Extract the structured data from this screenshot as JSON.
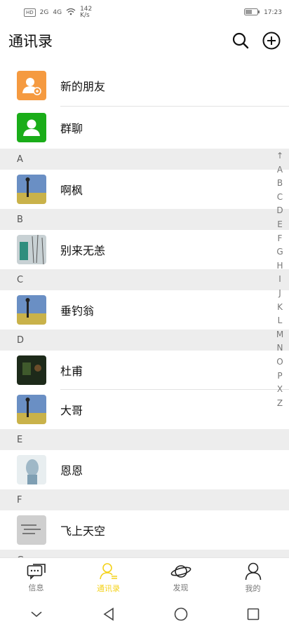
{
  "status": {
    "left_badge": "HD",
    "net1": "2G",
    "net2": "4G",
    "speed": "142\nK/s",
    "time": "17:23"
  },
  "header": {
    "title": "通讯录"
  },
  "top_items": [
    {
      "name": "新的朋友",
      "color": "#f59a40"
    },
    {
      "name": "群聊",
      "color": "#1aad19"
    }
  ],
  "sections": [
    {
      "letter": "A",
      "contacts": [
        "啊枫"
      ]
    },
    {
      "letter": "B",
      "contacts": [
        "别来无恙"
      ]
    },
    {
      "letter": "C",
      "contacts": [
        "垂钓翁"
      ]
    },
    {
      "letter": "D",
      "contacts": [
        "杜甫",
        "大哥"
      ]
    },
    {
      "letter": "E",
      "contacts": [
        "恩恩"
      ]
    },
    {
      "letter": "F",
      "contacts": [
        "飞上天空"
      ]
    },
    {
      "letter": "G",
      "contacts": []
    }
  ],
  "index": [
    "↑",
    "A",
    "B",
    "C",
    "D",
    "E",
    "F",
    "G",
    "H",
    "I",
    "J",
    "K",
    "L",
    "M",
    "N",
    "O",
    "P",
    "X",
    "Z"
  ],
  "tabs": [
    {
      "label": "信息",
      "active": false
    },
    {
      "label": "通讯录",
      "active": true
    },
    {
      "label": "发现",
      "active": false
    },
    {
      "label": "我的",
      "active": false
    }
  ],
  "accent": "#f4d21a"
}
